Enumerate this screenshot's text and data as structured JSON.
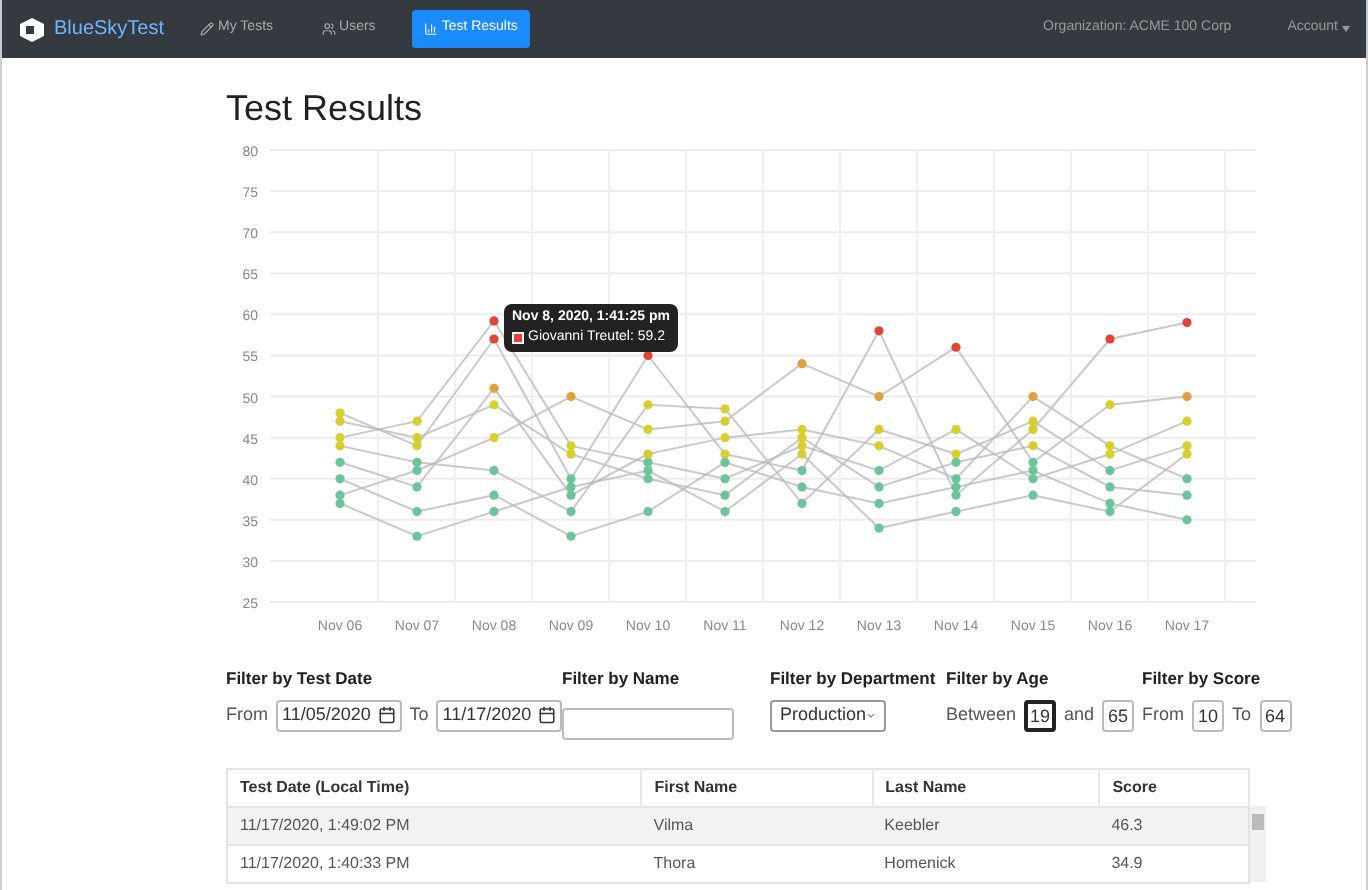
{
  "navbar": {
    "brand": "BlueSkyTest",
    "items": [
      {
        "label": "My Tests",
        "selected": false
      },
      {
        "label": "Users",
        "selected": false
      },
      {
        "label": "Test Results",
        "selected": true
      }
    ],
    "organization": "Organization: ACME 100 Corp",
    "account": "Account"
  },
  "title": "Test Results",
  "chart": {
    "chart_data": {
      "type": "line",
      "categories": [
        "Nov 06",
        "Nov 07",
        "Nov 08",
        "Nov 09",
        "Nov 10",
        "Nov 11",
        "Nov 12",
        "Nov 13",
        "Nov 14",
        "Nov 15",
        "Nov 16",
        "Nov 17"
      ],
      "ylim": [
        25,
        80
      ],
      "grid": true,
      "yticks": [
        25,
        30,
        35,
        40,
        45,
        50,
        55,
        60,
        65,
        70,
        75,
        80
      ],
      "series": [
        {
          "color": "#bbbbbb",
          "marker": true,
          "values": [
            45,
            47,
            59.2,
            44,
            42,
            40,
            44,
            41,
            46,
            40,
            43,
            47
          ]
        },
        {
          "color": "#bbbbbb",
          "marker": true,
          "values": [
            48,
            44,
            57,
            40,
            55,
            43,
            41,
            58,
            38,
            46,
            57,
            59
          ]
        },
        {
          "color": "#bbbbbb",
          "marker": true,
          "values": [
            38,
            41,
            45,
            50,
            46,
            47,
            54,
            50,
            56,
            42,
            49,
            50
          ]
        },
        {
          "color": "#bbbbbb",
          "marker": true,
          "values": [
            42,
            39,
            51,
            38,
            43,
            45,
            46,
            44,
            40,
            50,
            44,
            40
          ]
        },
        {
          "color": "#bbbbbb",
          "marker": true,
          "values": [
            40,
            36,
            38,
            33,
            36,
            42,
            39,
            37,
            39,
            41,
            37,
            35
          ]
        },
        {
          "color": "#bbbbbb",
          "marker": true,
          "values": [
            37,
            33,
            36,
            39,
            41,
            36,
            43,
            34,
            36,
            38,
            36,
            43
          ]
        },
        {
          "color": "#bbbbbb",
          "marker": true,
          "values": [
            44,
            42,
            41,
            36,
            49,
            48.5,
            37,
            46,
            43,
            47,
            41,
            44
          ]
        },
        {
          "color": "#bbbbbb",
          "marker": true,
          "values": [
            47,
            45,
            49,
            43,
            40,
            38,
            45,
            39,
            42,
            44,
            39,
            38
          ]
        }
      ]
    },
    "tooltip": {
      "title": "Nov 8, 2020, 1:41:25 pm",
      "label": "Giovanni Treutel: 59.2"
    }
  },
  "filters": [
    {
      "kind": "date",
      "label": "Filter by Test Date",
      "prefix": "From",
      "value": "11/05/2020",
      "middle": "To",
      "value2": "11/17/2020"
    },
    {
      "kind": "text",
      "label": "Filter by Name"
    },
    {
      "kind": "select",
      "label": "Filter by Department",
      "value": "Production"
    },
    {
      "kind": "range",
      "label": "Filter by Age",
      "prefix": "Between",
      "value": "19",
      "middle": "and",
      "value2": "65",
      "focused": true
    },
    {
      "kind": "range",
      "label": "Filter by Score",
      "prefix": "From",
      "value": "10",
      "middle": "To",
      "value2": "64",
      "focused": false
    }
  ],
  "table": {
    "columns": [
      "Test Date (Local Time)",
      "First Name",
      "Last Name",
      "Score"
    ],
    "rows": [
      [
        "11/17/2020, 1:49:02 PM",
        "Vilma",
        "Keebler",
        "46.3"
      ],
      [
        "11/17/2020, 1:40:33 PM",
        "Thora",
        "Homenick",
        "34.9"
      ]
    ]
  }
}
